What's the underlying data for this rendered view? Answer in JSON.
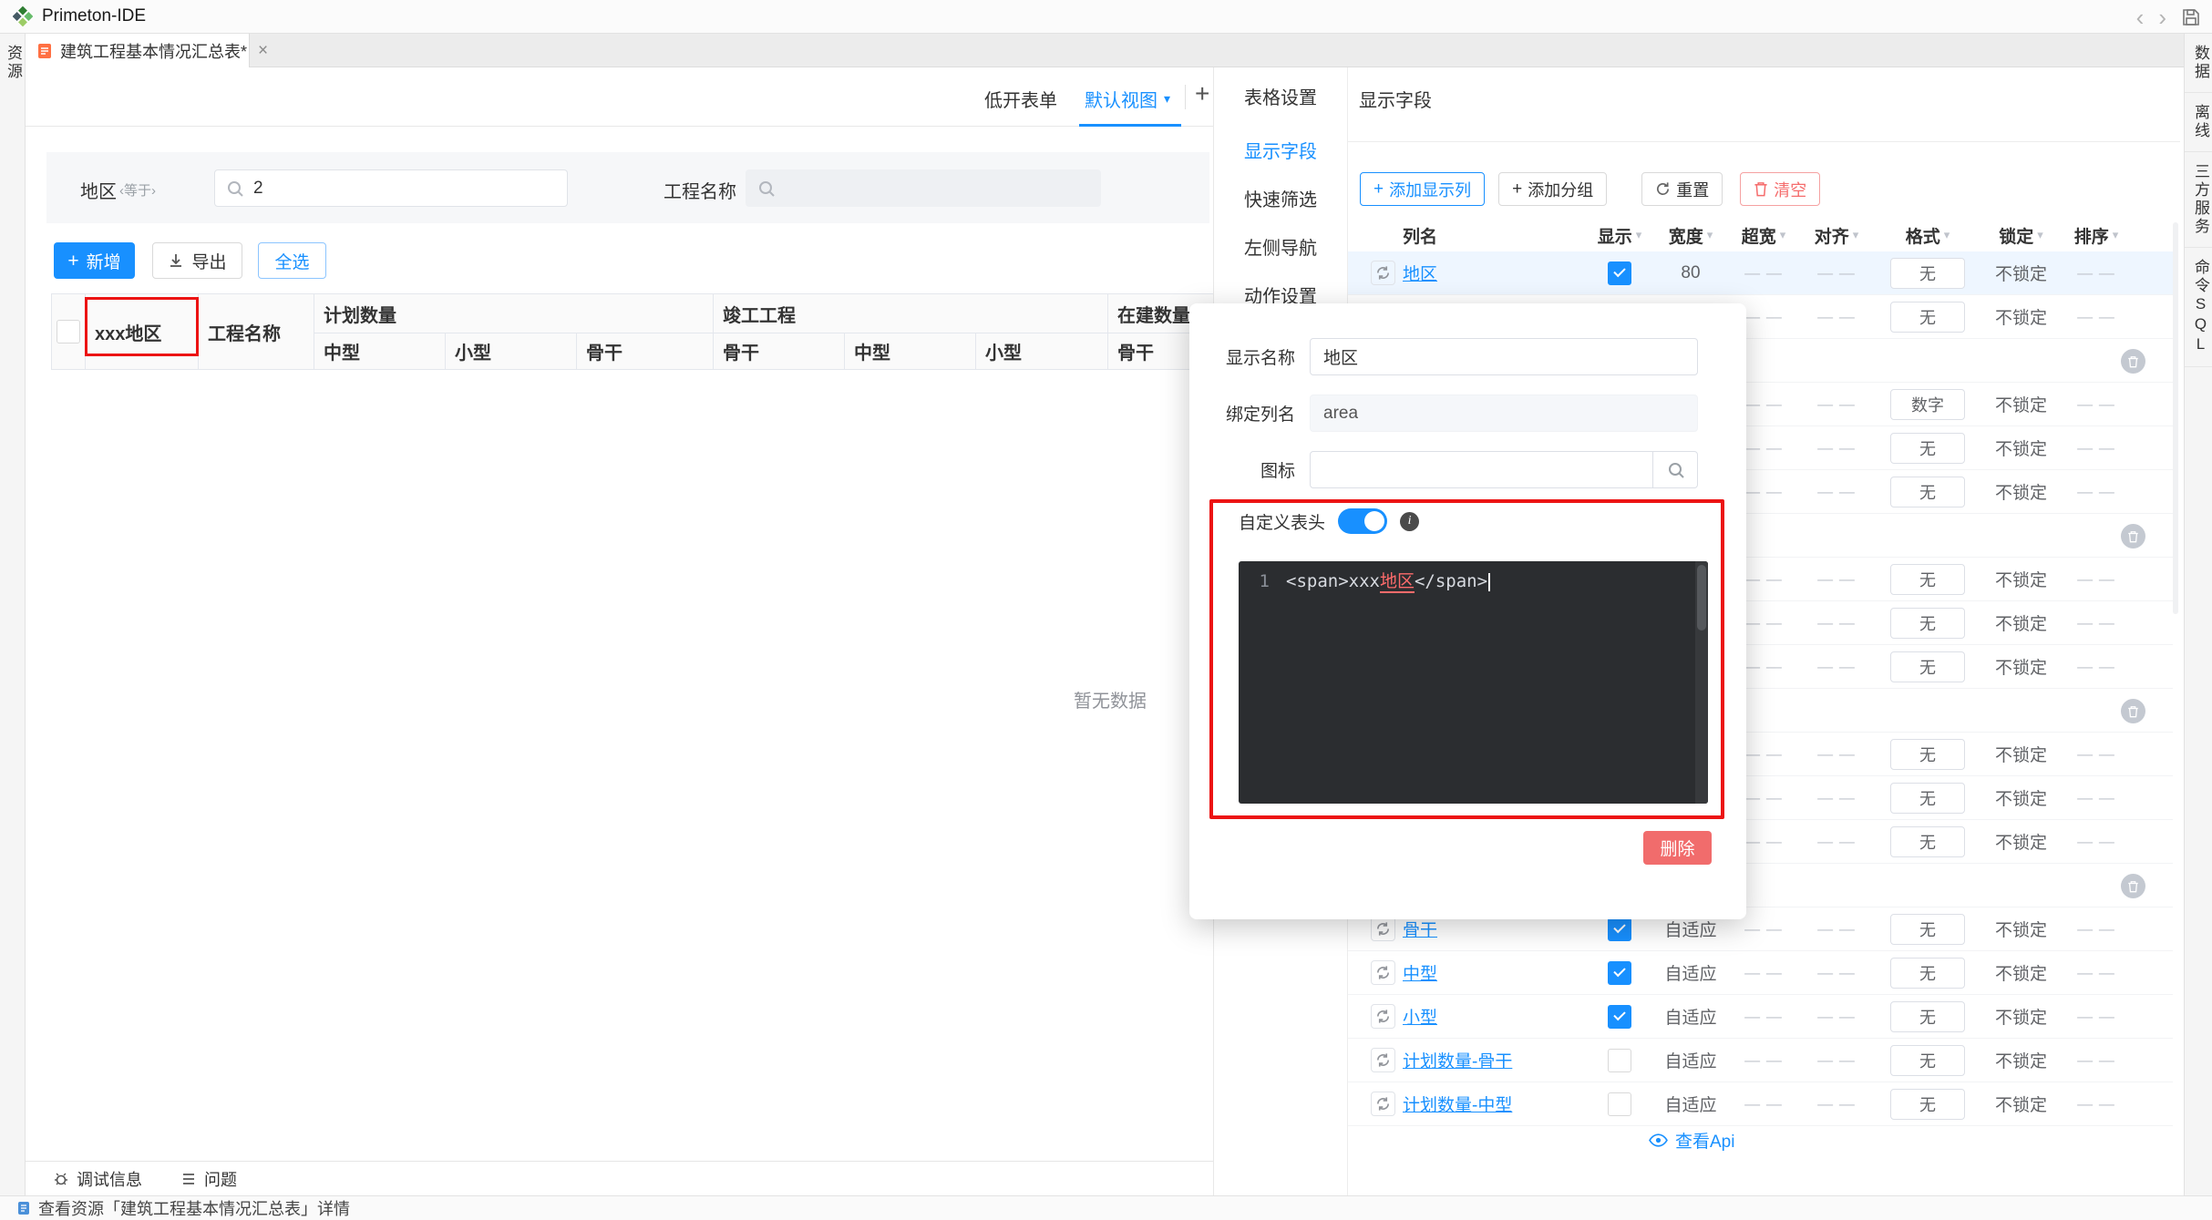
{
  "titlebar": {
    "app_title": "Primeton-IDE"
  },
  "tabbar": {
    "active_tab": "建筑工程基本情况汇总表*",
    "close": "×"
  },
  "left_strip": {
    "items": [
      "资源"
    ]
  },
  "right_strip": {
    "items": [
      "数据",
      "离线",
      "三方服务",
      "命令SQL"
    ]
  },
  "main_toolbar": {
    "form_type": "低开表单",
    "view_name": "默认视图",
    "add": "+"
  },
  "filterbar": {
    "area_label": "地区",
    "area_op": "等于",
    "area_value": "2",
    "project_label": "工程名称",
    "project_value": ""
  },
  "actionbar": {
    "add": "新增",
    "export": "导出",
    "select_all": "全选"
  },
  "main_grid": {
    "area_column": "xxx地区",
    "project_column": "工程名称",
    "groups": [
      {
        "label": "计划数量",
        "children": [
          "中型",
          "小型",
          "骨干"
        ]
      },
      {
        "label": "竣工工程",
        "children": [
          "骨干",
          "中型",
          "小型"
        ]
      },
      {
        "label": "在建数量",
        "children": [
          "骨干"
        ]
      }
    ],
    "empty_text": "暂无数据"
  },
  "settings": {
    "title": "表格设置",
    "nav": [
      {
        "label": "显示字段",
        "active": true
      },
      {
        "label": "快速筛选",
        "active": false
      },
      {
        "label": "左侧导航",
        "active": false
      },
      {
        "label": "动作设置",
        "active": false
      }
    ],
    "content_title": "显示字段",
    "buttons": {
      "add_column": "添加显示列",
      "add_group": "添加分组",
      "reset": "重置",
      "clear": "清空"
    },
    "grid_headers": [
      "列名",
      "显示",
      "宽度",
      "超宽",
      "对齐",
      "格式",
      "锁定",
      "排序"
    ],
    "rows": [
      {
        "type": "field",
        "name": "地区",
        "checked": true,
        "width": "80",
        "overwide": "— —",
        "align": "— —",
        "format": "无",
        "lock": "不锁定",
        "sort": "— —",
        "active": true
      },
      {
        "type": "field",
        "name": "",
        "checked": null,
        "width": "",
        "overwide": "— —",
        "align": "— —",
        "format": "无",
        "lock": "不锁定",
        "sort": "— —"
      },
      {
        "type": "group"
      },
      {
        "type": "field",
        "name": "",
        "checked": null,
        "width": "",
        "overwide": "— —",
        "align": "— —",
        "format": "数字",
        "lock": "不锁定",
        "sort": "— —"
      },
      {
        "type": "field",
        "name": "",
        "checked": null,
        "width": "",
        "overwide": "— —",
        "align": "— —",
        "format": "无",
        "lock": "不锁定",
        "sort": "— —"
      },
      {
        "type": "field",
        "name": "",
        "checked": null,
        "width": "",
        "overwide": "— —",
        "align": "— —",
        "format": "无",
        "lock": "不锁定",
        "sort": "— —"
      },
      {
        "type": "group"
      },
      {
        "type": "field",
        "name": "",
        "checked": null,
        "width": "",
        "overwide": "— —",
        "align": "— —",
        "format": "无",
        "lock": "不锁定",
        "sort": "— —"
      },
      {
        "type": "field",
        "name": "",
        "checked": null,
        "width": "",
        "overwide": "— —",
        "align": "— —",
        "format": "无",
        "lock": "不锁定",
        "sort": "— —"
      },
      {
        "type": "field",
        "name": "",
        "checked": null,
        "width": "",
        "overwide": "— —",
        "align": "— —",
        "format": "无",
        "lock": "不锁定",
        "sort": "— —"
      },
      {
        "type": "group"
      },
      {
        "type": "field",
        "name": "",
        "checked": null,
        "width": "",
        "overwide": "— —",
        "align": "— —",
        "format": "无",
        "lock": "不锁定",
        "sort": "— —"
      },
      {
        "type": "field",
        "name": "",
        "checked": null,
        "width": "",
        "overwide": "— —",
        "align": "— —",
        "format": "无",
        "lock": "不锁定",
        "sort": "— —"
      },
      {
        "type": "field",
        "name": "",
        "checked": null,
        "width": "",
        "overwide": "— —",
        "align": "— —",
        "format": "无",
        "lock": "不锁定",
        "sort": "— —"
      },
      {
        "type": "group"
      },
      {
        "type": "field",
        "name": "骨干",
        "checked": true,
        "width": "自适应",
        "overwide": "— —",
        "align": "— —",
        "format": "无",
        "lock": "不锁定",
        "sort": "— —"
      },
      {
        "type": "field",
        "name": "中型",
        "checked": true,
        "width": "自适应",
        "overwide": "— —",
        "align": "— —",
        "format": "无",
        "lock": "不锁定",
        "sort": "— —"
      },
      {
        "type": "field",
        "name": "小型",
        "checked": true,
        "width": "自适应",
        "overwide": "— —",
        "align": "— —",
        "format": "无",
        "lock": "不锁定",
        "sort": "— —"
      },
      {
        "type": "field",
        "name": "计划数量-骨干",
        "checked": false,
        "width": "自适应",
        "overwide": "— —",
        "align": "— —",
        "format": "无",
        "lock": "不锁定",
        "sort": "— —"
      },
      {
        "type": "field",
        "name": "计划数量-中型",
        "checked": false,
        "width": "自适应",
        "overwide": "— —",
        "align": "— —",
        "format": "无",
        "lock": "不锁定",
        "sort": "— —"
      }
    ],
    "view_api": "查看Api"
  },
  "dialog": {
    "display_name_label": "显示名称",
    "display_name_value": "地区",
    "bind_column_label": "绑定列名",
    "bind_column_value": "area",
    "icon_label": "图标",
    "icon_value": "",
    "custom_header_label": "自定义表头",
    "toggle_on": true,
    "editor": {
      "line_number": "1",
      "code_before": "<span>xxx",
      "code_highlight": "地区",
      "code_after": "</span>"
    },
    "delete_label": "删除"
  },
  "debugbar": {
    "debug": "调试信息",
    "problems": "问题"
  },
  "statusbar": {
    "text": "查看资源「建筑工程基本情况汇总表」详情"
  },
  "colors": {
    "accent": "#1890ff",
    "danger": "#f56c6c",
    "annotation": "#ec1313",
    "editor_highlight": "#ff6b6b"
  }
}
